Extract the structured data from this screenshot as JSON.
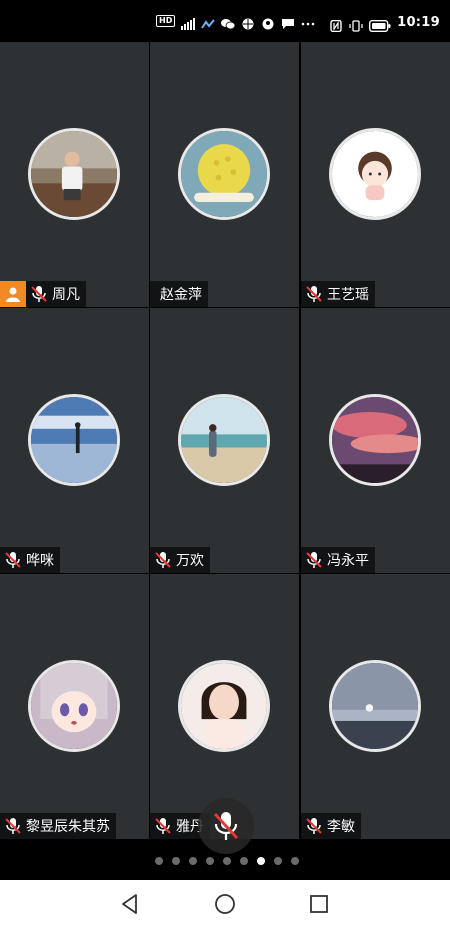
{
  "status_bar": {
    "hd": "HD",
    "network": "4G",
    "time": "10:19"
  },
  "participants": [
    {
      "name": "周凡",
      "host": true,
      "muted": true
    },
    {
      "name": "赵金萍",
      "host": false,
      "muted": false
    },
    {
      "name": "王艺瑶",
      "host": false,
      "muted": true
    },
    {
      "name": "哗咪",
      "host": false,
      "muted": true
    },
    {
      "name": "万欢",
      "host": false,
      "muted": true
    },
    {
      "name": "冯永平",
      "host": false,
      "muted": true
    },
    {
      "name": "黎昱辰朱其苏",
      "host": false,
      "muted": true
    },
    {
      "name": "雅丹",
      "host": false,
      "muted": true
    },
    {
      "name": "李敏",
      "host": false,
      "muted": true
    }
  ],
  "pager": {
    "count": 9,
    "active_index": 6
  },
  "colors": {
    "tile_bg": "#2e3134",
    "host_badge": "#f08a24",
    "mute_red": "#e53935"
  }
}
